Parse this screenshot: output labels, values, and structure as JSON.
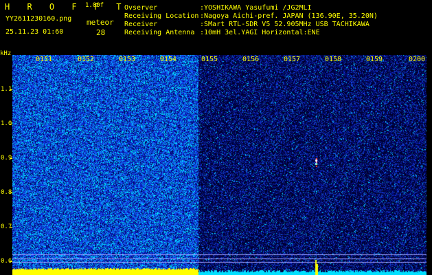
{
  "header": {
    "app_title": "H R O F F T",
    "version": "1.00f",
    "filename": "YY2611230160.png",
    "meteor_label": "meteor",
    "datetime": "25.11.23 01:60",
    "meteor_count": "28"
  },
  "info": [
    {
      "label": "Ovserver",
      "value": ":YOSHIKAWA Yasufumi /JG2MLI"
    },
    {
      "label": "Receiving Location",
      "value": ":Nagoya Aichi-pref. JAPAN (136.90E, 35.20N)"
    },
    {
      "label": "Receiver",
      "value": ":SMart RTL-SDR V5 52.905MHz USB TACHIKAWA"
    },
    {
      "label": "Receiving Antenna",
      "value": ":10mH 3el.YAGI Horizontal:ENE"
    }
  ],
  "spectrogram": {
    "unit": "kHz",
    "time_labels": [
      "0151",
      "0152",
      "0153",
      "0154",
      "0155",
      "0156",
      "0157",
      "0158",
      "0159",
      "0200"
    ],
    "freq_labels": [
      "1.1",
      "1.0",
      "0.9",
      "0.8",
      "0.7",
      "0.6"
    ],
    "freq_range": [
      0.58,
      1.18
    ],
    "split_time_label": "0155",
    "meteor_echo": {
      "time": "0157.5",
      "freq": 0.9
    },
    "colors": {
      "label": "#ffff00",
      "noise_high": "#00ffff",
      "noise_mid": "#1c3cff",
      "noise_low": "#000060",
      "signal_bar": "#ffff00",
      "signal_bar_quiet": "#00e0ff",
      "ref_line": "#a0a0ff"
    }
  }
}
